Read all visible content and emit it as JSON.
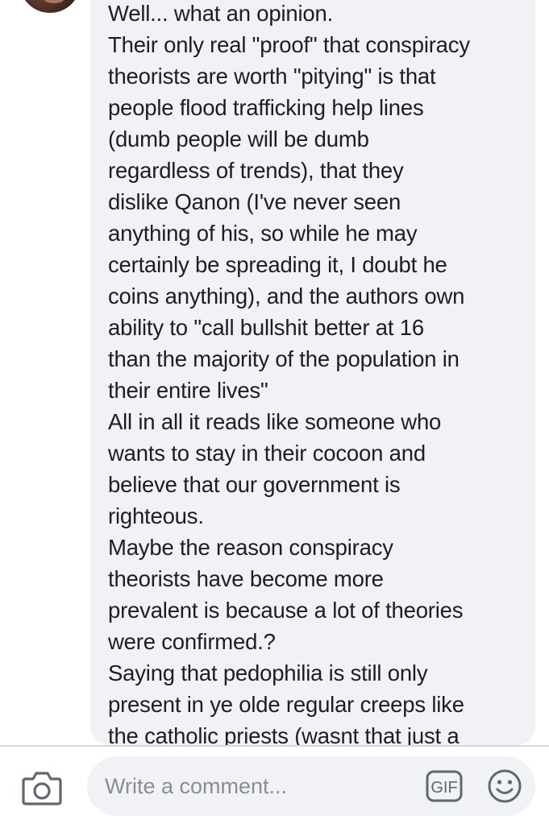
{
  "comment": {
    "lines": [
      "Well... what an opinion.",
      "Their only real \"proof\" that conspiracy",
      "theorists are worth \"pitying\" is that",
      "people flood trafficking help lines",
      "(dumb people will be dumb",
      "regardless of trends), that they",
      "dislike Qanon (I've never seen",
      "anything of his, so while he may",
      "certainly be spreading it, I doubt he",
      "coins anything), and the authors own",
      "ability to \"call bullshit better at 16",
      "than the majority of the population in",
      "their entire lives\"",
      "All in all it reads like someone who",
      "wants to stay in their cocoon and",
      "believe that our government is",
      "righteous.",
      "Maybe the reason conspiracy",
      "theorists have become more",
      "prevalent is because a lot of theories",
      "were confirmed.?",
      "Saying that pedophilia is still only",
      "present in ye olde regular creeps like",
      "the catholic priests (wasnt that just a"
    ]
  },
  "composer": {
    "placeholder": "Write a comment...",
    "gif_label": "GIF"
  },
  "icons": {
    "camera": "camera-icon",
    "gif": "gif-icon",
    "emoji": "smiley-face-icon"
  },
  "colors": {
    "bubble_background": "#f0f2f5",
    "text": "#1c1e21",
    "placeholder": "#8a8d91",
    "icon": "#606770"
  }
}
